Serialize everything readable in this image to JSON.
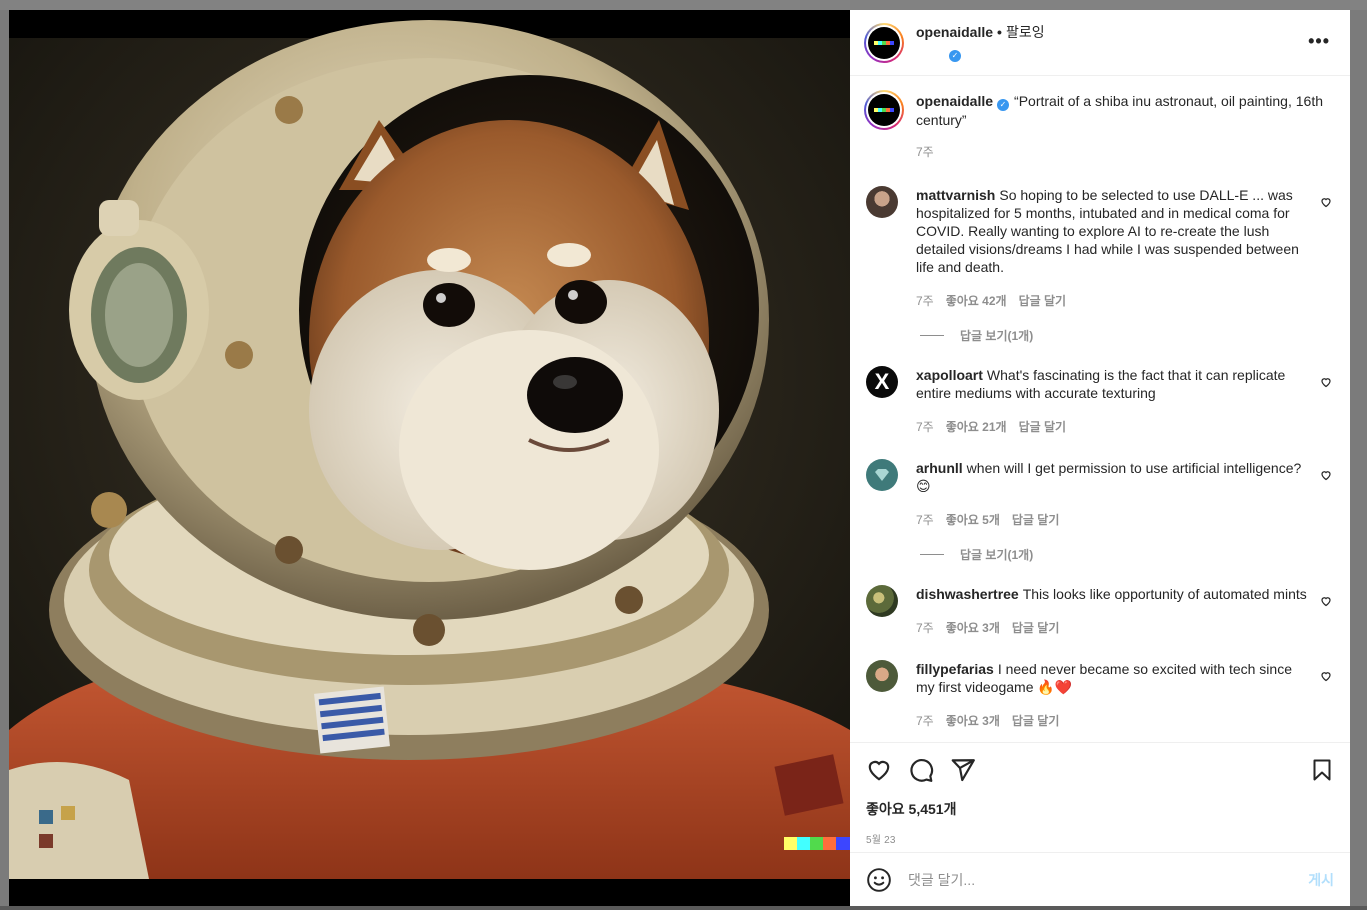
{
  "post": {
    "author": "openaidalle",
    "follow_sep": "•",
    "follow_label": "팔로잉",
    "verified": true,
    "caption": "“Portrait of a shiba inu astronaut, oil painting, 16th century”",
    "caption_time": "7주",
    "more_icon": "more-horizontal-icon",
    "image_alt_subject": "shiba inu astronaut oil painting",
    "dalle_colors": [
      "#ffff66",
      "#42ffff",
      "#51da4c",
      "#ff6e3c",
      "#3c46ff"
    ]
  },
  "comments": [
    {
      "user": "mattvarnish",
      "text": "So hoping to be selected to use DALL-E ... was hospitalized for 5 months, intubated and in medical coma for COVID. Really wanting to explore AI to re-create the lush detailed visions/dreams I had while I was suspended between life and death.",
      "time": "7주",
      "likes": "좋아요 42개",
      "reply": "답글 달기",
      "view_replies": "답글 보기(1개)"
    },
    {
      "user": "xapolloart",
      "text": "What's fascinating is the fact that it can replicate entire mediums with accurate texturing",
      "time": "7주",
      "likes": "좋아요 21개",
      "reply": "답글 달기",
      "view_replies": ""
    },
    {
      "user": "arhunll",
      "text": "when will I get permission to use artificial intelligence? 😊",
      "time": "7주",
      "likes": "좋아요 5개",
      "reply": "답글 달기",
      "view_replies": "답글 보기(1개)"
    },
    {
      "user": "dishwashertree",
      "text": "This looks like opportunity of automated mints",
      "time": "7주",
      "likes": "좋아요 3개",
      "reply": "답글 달기",
      "view_replies": ""
    },
    {
      "user": "fillypefarias",
      "text": "I need never became so excited with tech since my first videogame 🔥❤️",
      "time": "7주",
      "likes": "좋아요 3개",
      "reply": "답글 달기",
      "view_replies": ""
    }
  ],
  "actions": {
    "like_icon": "heart-icon",
    "comment_icon": "comment-bubble-icon",
    "share_icon": "paper-plane-icon",
    "save_icon": "bookmark-icon",
    "likes_count": "좋아요 5,451개",
    "date": "5월 23"
  },
  "input": {
    "emoji_icon": "smiley-icon",
    "placeholder": "댓글 달기...",
    "post_label": "게시"
  },
  "colors": {
    "verified": "#3897f0",
    "post_button": "#b2dffc",
    "muted_text": "#8e8e8e"
  }
}
